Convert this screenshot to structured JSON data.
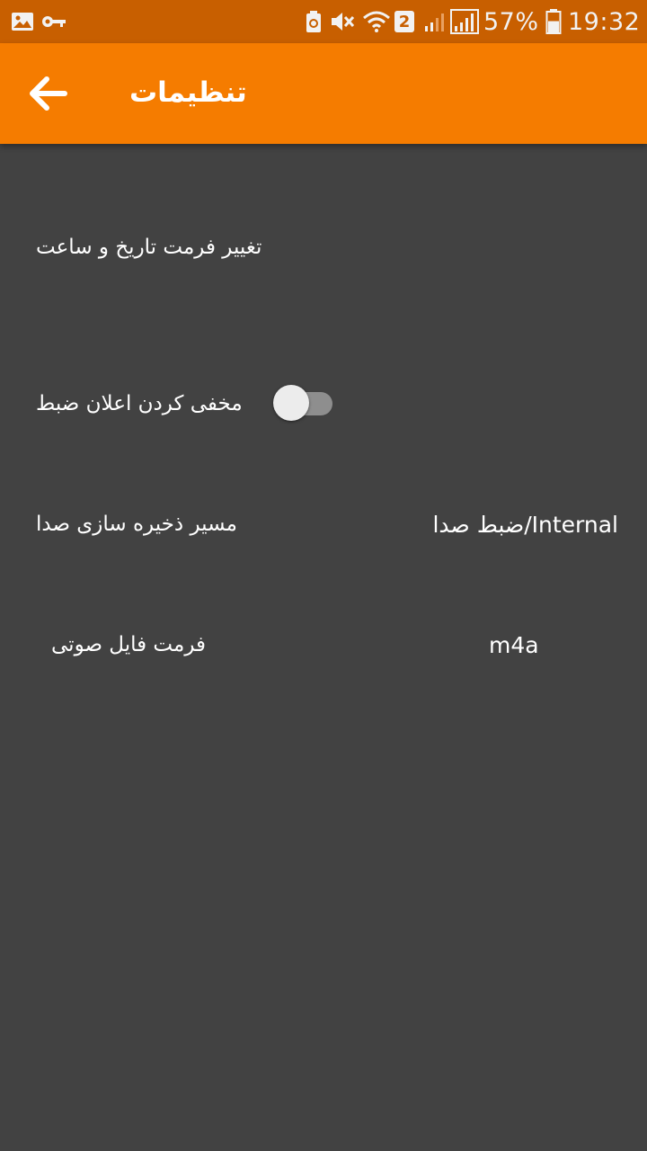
{
  "status_bar": {
    "battery_percent": "57%",
    "time": "19:32",
    "sim_badge": "2",
    "icons": [
      "image-icon",
      "key-icon",
      "recycle-icon",
      "mute-icon",
      "wifi-icon",
      "signal-icon",
      "signal-icon",
      "battery-icon"
    ],
    "battery_level": 0.57
  },
  "app_bar": {
    "title": "تنظیمات",
    "back_icon": "arrow-back-icon"
  },
  "settings": {
    "date_time_format_label": "تغییر فرمت تاریخ و ساعت",
    "hide_notification_label": "مخفی کردن اعلان ضبط",
    "hide_notification_on": false,
    "storage_path_label": "مسیر ذخیره سازی صدا",
    "storage_path_value": "Internal/ضبط صدا",
    "audio_format_label": "فرمت فایل صوتی",
    "audio_format_value": "m4a"
  },
  "colors": {
    "status_bar": "#c85f00",
    "app_bar": "#f57c00",
    "background": "#424242"
  }
}
